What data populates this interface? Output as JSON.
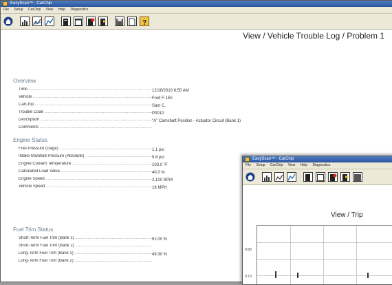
{
  "main_window": {
    "title": "EasyScan™ · CarChip",
    "menu": [
      "File",
      "Setup",
      "CarChip",
      "View",
      "Help",
      "Diagnostics"
    ],
    "page_title": "View / Vehicle Trouble Log / Problem 1",
    "sections": [
      {
        "title": "Overview",
        "rows": [
          {
            "label": "Time",
            "value": "12/18/2010 6:50 AM"
          },
          {
            "label": "Vehicle",
            "value": "Ford F-150"
          },
          {
            "label": "CarChip",
            "value": "Sam C."
          },
          {
            "label": "Trouble Code",
            "value": "P0010"
          },
          {
            "label": "Description",
            "value": "\"A\" Camshaft Position - Actuator Circuit (Bank 1)"
          },
          {
            "label": "Comments",
            "value": ""
          }
        ]
      },
      {
        "title": "Engine Status",
        "rows": [
          {
            "label": "Fuel Pressure (Gage)",
            "value": "1.1 psi"
          },
          {
            "label": "Intake Manifold Pressure (Absolute)",
            "value": "9.8 psi"
          },
          {
            "label": "Engine Coolant Temperature",
            "value": "103.0 °F"
          },
          {
            "label": "Calculated Load Value",
            "value": "40.0 %"
          },
          {
            "label": "Engine Speed",
            "value": "2,100 RPM"
          },
          {
            "label": "Vehicle Speed",
            "value": "18 MPH"
          }
        ]
      },
      {
        "title": "Fuel Trim Status",
        "rows": [
          {
            "label": "Short-Term Fuel Trim (Bank 1)",
            "value": "52.00 %"
          },
          {
            "label": "Short-Term Fuel Trim (Bank 2)",
            "value": ""
          },
          {
            "label": "Long-Term Fuel Trim (Bank 1)",
            "value": "49.30 %"
          },
          {
            "label": "Long-Term Fuel Trim (Bank 2)",
            "value": ""
          }
        ]
      }
    ]
  },
  "second_window": {
    "title": "EasyScan™ · CarChip",
    "menu": [
      "File",
      "Setup",
      "CarChip",
      "View",
      "Help",
      "Diagnostics"
    ],
    "page_title": "View / Trip",
    "axis_ticks": [
      "0.80",
      "0.70"
    ]
  },
  "toolbar_icons": [
    "home-icon",
    "chart-icon",
    "compare-icon",
    "graph-icon",
    "doc-icon",
    "window-icon",
    "alert-doc-icon",
    "flag-doc-icon",
    "disk-icon",
    "page-icon",
    "help-icon"
  ]
}
